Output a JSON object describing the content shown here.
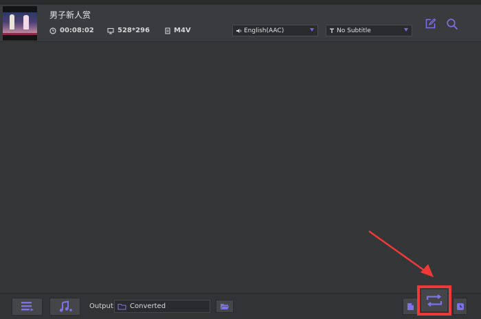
{
  "file": {
    "title": "男子新人赏",
    "duration": "00:08:02",
    "resolution": "528*296",
    "format": "M4V",
    "audio_track": "English(AAC)",
    "subtitle": "No Subtitle"
  },
  "footer": {
    "output_label": "Output:",
    "output_value": "Converted"
  },
  "icons": {
    "clock": "clock-icon",
    "screen": "monitor-icon",
    "format": "file-format-icon",
    "audio": "speaker-icon",
    "subtitle": "text-t-icon",
    "edit": "edit-icon",
    "search": "search-icon",
    "add_files": "add-files-icon",
    "add_music": "add-music-icon",
    "folder": "folder-icon",
    "browse": "open-folder-icon",
    "convert": "convert-icon"
  },
  "colors": {
    "background": "#353638",
    "accent": "#7b73e6",
    "annotation": "#f03a3a"
  }
}
